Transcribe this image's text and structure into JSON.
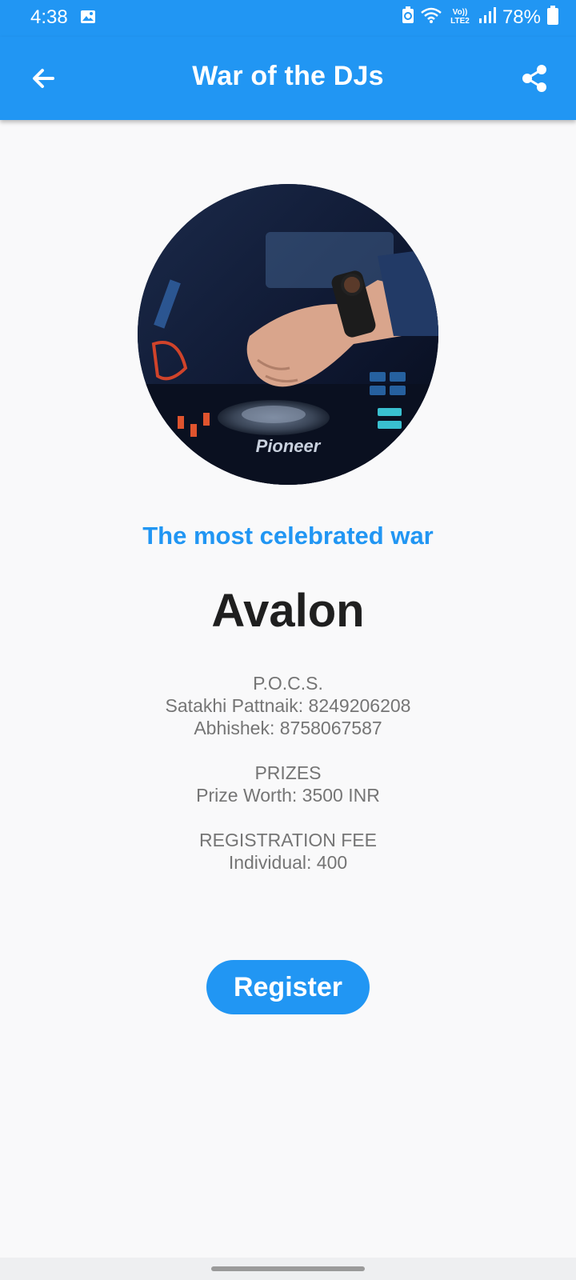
{
  "status_bar": {
    "time": "4:38",
    "network_label": "Vo)) LTE2",
    "battery": "78%"
  },
  "app_bar": {
    "title": "War of the DJs",
    "back_icon": "arrow-left-icon",
    "share_icon": "share-icon"
  },
  "hero": {
    "image": "dj-mixer-photo",
    "brand_text": "Pioneer"
  },
  "tagline": "The most celebrated war",
  "event_name": "Avalon",
  "pocs": {
    "heading": "P.O.C.S.",
    "contacts": [
      "Satakhi Pattnaik: 8249206208",
      "Abhishek: 8758067587"
    ]
  },
  "prizes": {
    "heading": "PRIZES",
    "worth": "Prize Worth: 3500 INR"
  },
  "registration": {
    "heading": "REGISTRATION FEE",
    "individual": "Individual: 400"
  },
  "register_button": "Register",
  "colors": {
    "primary": "#2196f3",
    "background": "#f9f9fa",
    "title_text": "#1f1f1f",
    "info_text": "#757575"
  }
}
